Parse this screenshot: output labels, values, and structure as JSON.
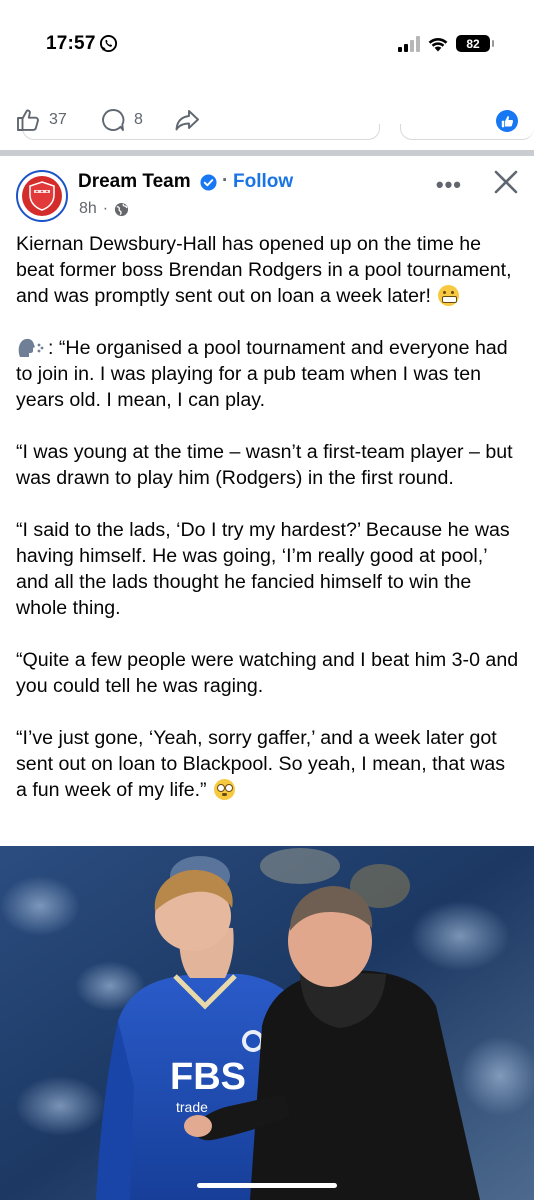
{
  "status_bar": {
    "time": "17:57",
    "battery": "82"
  },
  "prior_post": {
    "like_count": "37",
    "comment_count": "8"
  },
  "post": {
    "page_name": "Dream Team",
    "follow_label": "Follow",
    "separator": "·",
    "time_ago": "8h",
    "more_label": "•••",
    "paragraphs": [
      "Kiernan Dewsbury-Hall has opened up on the time he beat former boss Brendan Rodgers in a pool tournament, and was promptly sent out on loan a week later!",
      "“He organised a pool tournament and everyone had to join in. I was playing for a pub team when I was ten years old. I mean, I can play.",
      "“I was young at the time – wasn’t a first-team player – but was drawn to play him (Rodgers) in the first round.",
      "“I said to the lads, ‘Do I try my hardest?’ Because he was having himself. He was going, ‘I’m really good at pool,’ and all the lads thought he fancied himself to win the whole thing.",
      "“Quite a few people were watching and I beat him 3-0 and you could tell he was raging.",
      "“I’ve just gone, ‘Yeah, sorry gaffer,’ and a week later got sent out on loan to Blackpool. So yeah, I mean, that was a fun week of my life.”"
    ],
    "speaker_suffix": ":",
    "photo": {
      "shirt_sponsor": "FBS",
      "shirt_sponsor_sub": "trade"
    }
  },
  "colors": {
    "accent": "#1b74e4",
    "text": "#050505",
    "muted": "#65676b",
    "separator": "#c9ccd1",
    "kit_blue": "#1f4fb8",
    "coat_black": "#151515"
  },
  "icons": [
    "whatsapp-icon",
    "signal-icon",
    "wifi-icon",
    "battery-icon",
    "like-icon",
    "comment-icon",
    "share-icon",
    "like-reaction-icon",
    "verified-icon",
    "globe-icon",
    "more-icon",
    "close-icon",
    "speaking-head-icon",
    "grimacing-face-icon",
    "flushed-face-icon"
  ]
}
